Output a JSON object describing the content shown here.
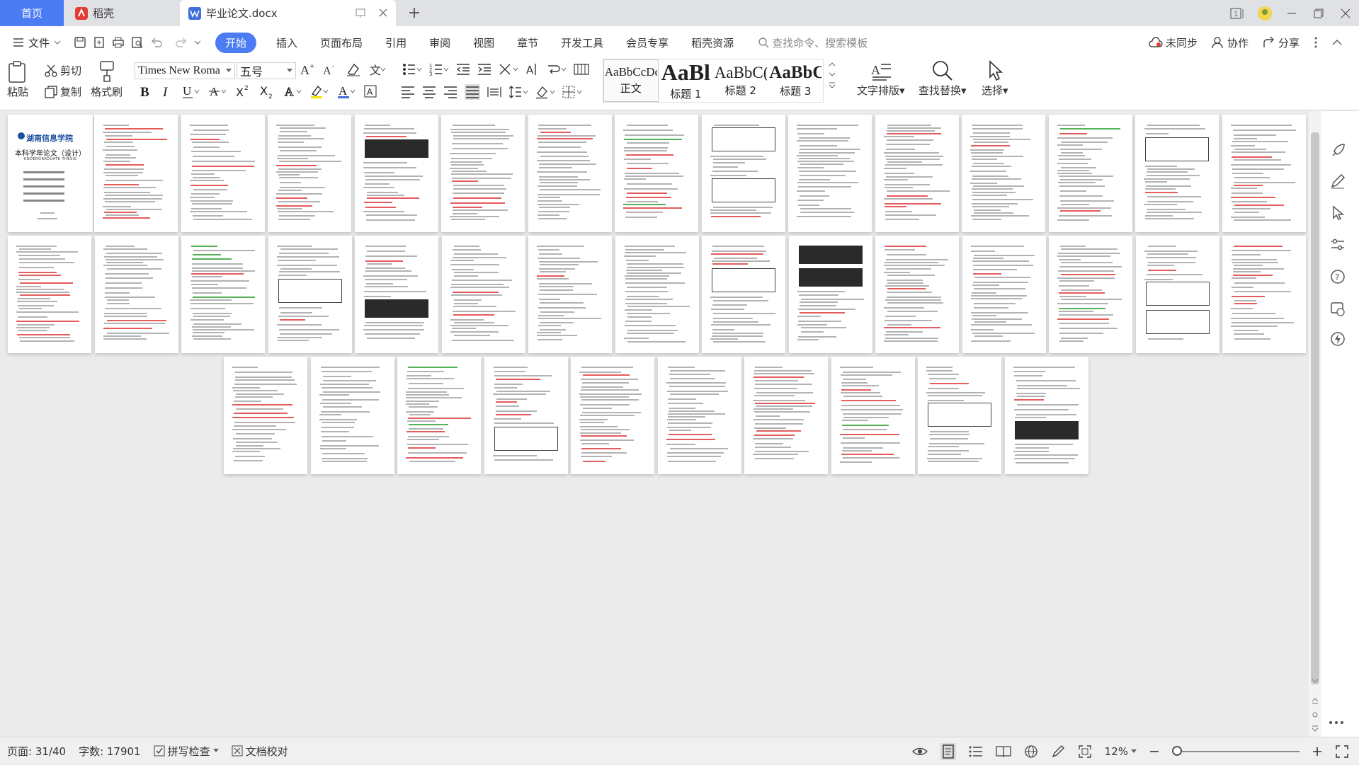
{
  "tabs": {
    "home": "首页",
    "docer": "稻壳",
    "document": "毕业论文.docx"
  },
  "menu": {
    "file": "文件",
    "start": "开始",
    "items": [
      "插入",
      "页面布局",
      "引用",
      "审阅",
      "视图",
      "章节",
      "开发工具",
      "会员专享",
      "稻壳资源"
    ],
    "search_placeholder": "查找命令、搜索模板",
    "unsynced": "未同步",
    "collaborate": "协作",
    "share": "分享"
  },
  "ribbon": {
    "paste": "粘贴",
    "cut": "剪切",
    "copy": "复制",
    "format_painter": "格式刷",
    "font_family": "Times New Roma",
    "font_size": "五号",
    "styles": [
      {
        "sample": "AaBbCcDd",
        "label": "正文"
      },
      {
        "sample": "AaBl",
        "label": "标题 1"
      },
      {
        "sample": "AaBbC(",
        "label": "标题 2"
      },
      {
        "sample": "AaBbC",
        "label": "标题 3"
      }
    ],
    "text_layout": "文字排版",
    "find_replace": "查找替换",
    "select": "选择"
  },
  "cover_page": {
    "school": "湖南信息学院",
    "title": "本科学年论文（设计）",
    "subtitle": "UNDERGRADUATE THESIS"
  },
  "status": {
    "page": "页面: 31/40",
    "words": "字数: 17901",
    "spell_check": "拼写检查",
    "doc_proof": "文档校对",
    "zoom": "12%"
  },
  "colors": {
    "accent": "#4b7cf3",
    "wps_red": "#e13b33"
  }
}
